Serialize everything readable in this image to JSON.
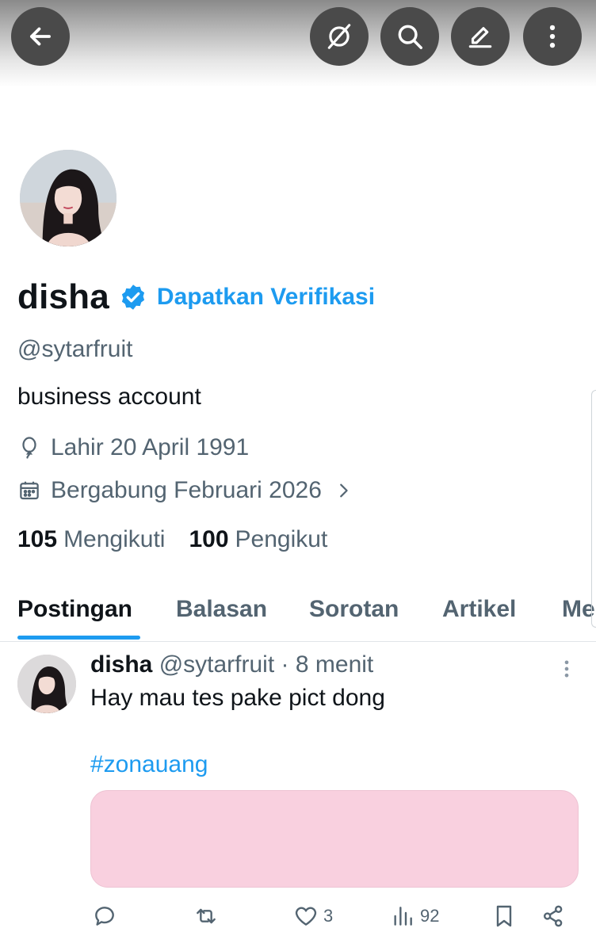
{
  "toolbar": {
    "back_icon": "arrow-left-icon",
    "grok_icon": "grok-icon",
    "search_icon": "search-icon",
    "edit_icon": "edit-icon",
    "more_icon": "more-vertical-icon"
  },
  "profile": {
    "display_name": "disha",
    "verified_badge_icon": "verified-badge-icon",
    "get_verified_label": "Dapatkan Verifikasi",
    "handle": "@sytarfruit",
    "bio": "business account",
    "birth": "Lahir 20 April 1991",
    "joined": "Bergabung Februari 2026",
    "following_count": "105",
    "following_label": "Mengikuti",
    "followers_count": "100",
    "followers_label": "Pengikut"
  },
  "tabs": [
    {
      "label": "Postingan",
      "active": true
    },
    {
      "label": "Balasan",
      "active": false
    },
    {
      "label": "Sorotan",
      "active": false
    },
    {
      "label": "Artikel",
      "active": false
    },
    {
      "label": "Me",
      "active": false
    }
  ],
  "post": {
    "author_name": "disha",
    "author_handle": "@sytarfruit",
    "separator": "·",
    "time": "8 menit",
    "text": "Hay mau tes pake pict dong",
    "hashtag": "#zonauang",
    "media_color": "#f9d0df",
    "actions": {
      "reply_count": "",
      "repost_count": "",
      "like_count": "3",
      "view_count": "92"
    }
  },
  "colors": {
    "accent": "#1d9bf0",
    "text_primary": "#0f1419",
    "text_secondary": "#536471"
  }
}
